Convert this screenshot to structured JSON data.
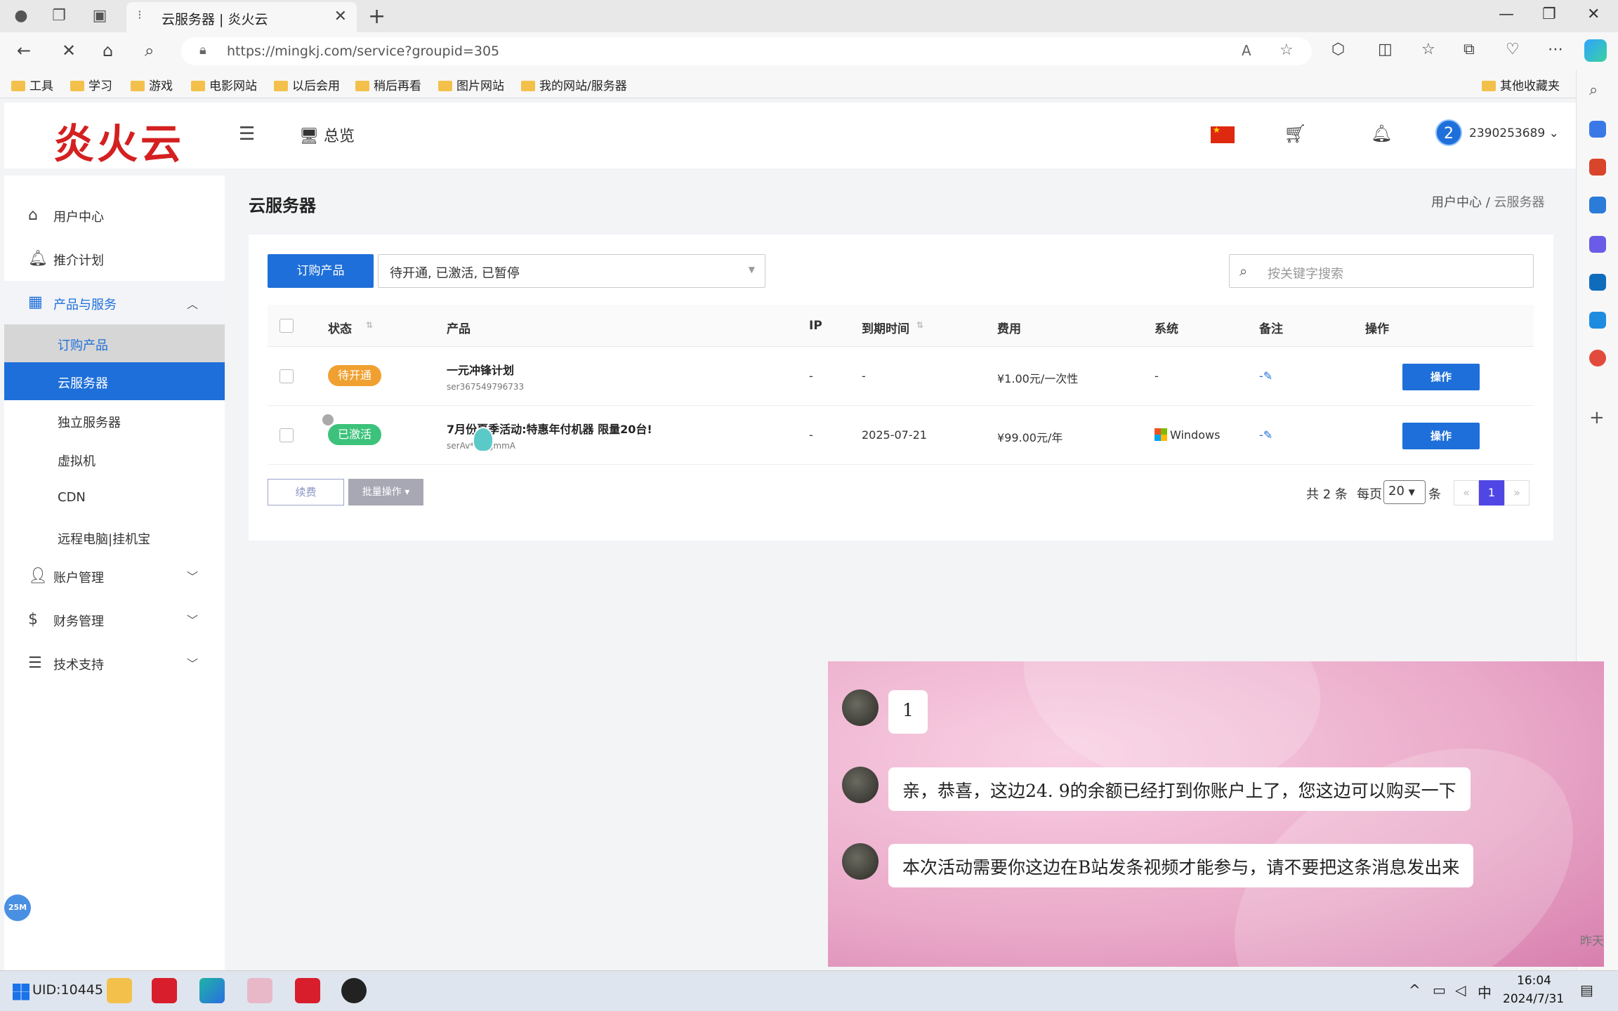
{
  "browser": {
    "tab_title": "云服务器 | 炎火云",
    "url": "https://mingkj.com/service?groupid=305",
    "bookmarks": [
      "工具",
      "学习",
      "游戏",
      "电影网站",
      "以后会用",
      "稍后再看",
      "图片网站",
      "我的网站/服务器"
    ],
    "other_bookmarks": "其他收藏夹"
  },
  "header": {
    "logo": "炎火云",
    "overview": "总览",
    "avatar_num": "2",
    "username": "2390253689"
  },
  "sidebar": {
    "items": [
      {
        "label": "用户中心",
        "icon": "home-icon"
      },
      {
        "label": "推介计划",
        "icon": "bell-icon"
      },
      {
        "label": "产品与服务",
        "icon": "grid-icon"
      },
      {
        "label": "账户管理",
        "icon": "user-icon"
      },
      {
        "label": "财务管理",
        "icon": "dollar-icon"
      },
      {
        "label": "技术支持",
        "icon": "doc-icon"
      }
    ],
    "sub": [
      "订购产品",
      "云服务器",
      "独立服务器",
      "虚拟机",
      "CDN",
      "远程电脑|挂机宝"
    ]
  },
  "main": {
    "title": "云服务器",
    "breadcrumb_1": "用户中心",
    "breadcrumb_sep": "/",
    "breadcrumb_2": "云服务器",
    "order_button": "订购产品",
    "status_filter": "待开通, 已激活, 已暂停",
    "search_placeholder": "按关键字搜索",
    "columns": [
      "状态",
      "产品",
      "IP",
      "到期时间",
      "费用",
      "系统",
      "备注",
      "操作"
    ],
    "rows": [
      {
        "status": "待开通",
        "status_color": "#f0a030",
        "product": "一元冲锋计划",
        "product_id": "ser367549796733",
        "ip": "-",
        "expire": "-",
        "fee": "¥1.00元/一次性",
        "os": "-",
        "note": "-",
        "action": "操作"
      },
      {
        "status": "已激活",
        "status_color": "#3cc27a",
        "product": "7月份夏季活动:特惠年付机器 限量20台!",
        "product_id": "serAv***9gmmA",
        "ip": "-",
        "expire": "2025-07-21",
        "fee": "¥99.00元/年",
        "os": "Windows",
        "note": "-",
        "action": "操作"
      }
    ],
    "renew_button": "续费",
    "batch_button": "批量操作",
    "pager": {
      "total": "共 2 条",
      "per_page_label": "每页",
      "per_page": "20",
      "unit": "条",
      "current": "1",
      "prev": "«",
      "next": "»"
    }
  },
  "chat": {
    "messages": [
      "1",
      "亲，恭喜，这边24. 9的余额已经打到你账户上了，您这边可以购买一下",
      "本次活动需要你这边在B站发条视频才能参与，请不要把这条消息发出来"
    ],
    "time": "昨天"
  },
  "taskbar": {
    "uid": "UID:10445 13",
    "time": "16:04",
    "date": "2024/7/31",
    "ime": "中",
    "badge": "25M"
  }
}
